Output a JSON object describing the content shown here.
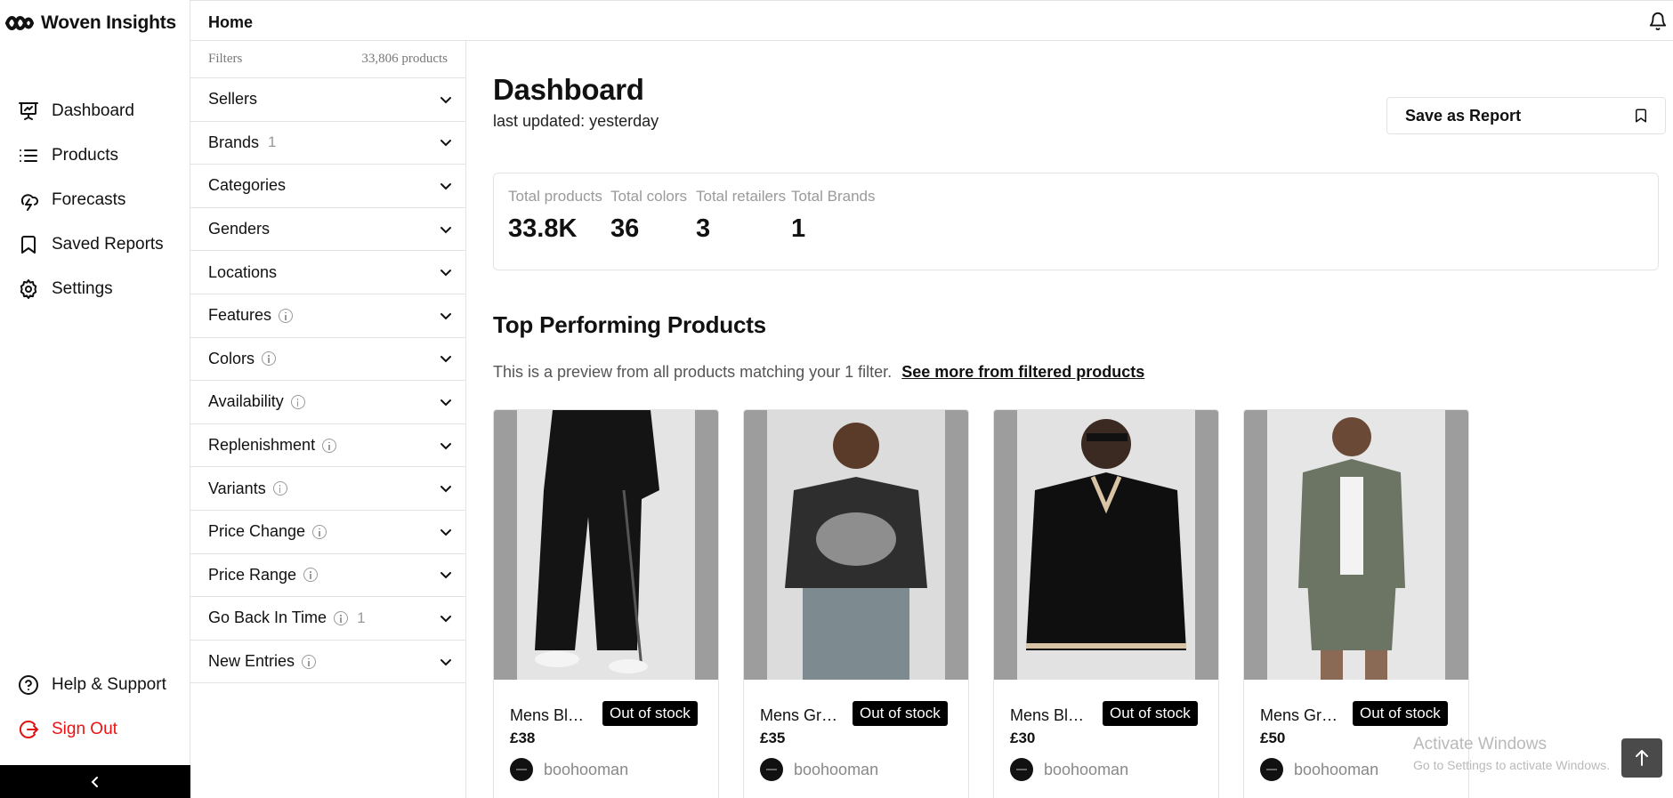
{
  "brand": {
    "name": "Woven Insights"
  },
  "nav": {
    "items": [
      {
        "label": "Dashboard",
        "icon": "presentation-icon"
      },
      {
        "label": "Products",
        "icon": "list-icon"
      },
      {
        "label": "Forecasts",
        "icon": "cloud-lightning-icon"
      },
      {
        "label": "Saved Reports",
        "icon": "bookmark-icon"
      },
      {
        "label": "Settings",
        "icon": "gear-icon"
      }
    ],
    "bottom": [
      {
        "label": "Help & Support",
        "icon": "help-icon"
      },
      {
        "label": "Sign Out",
        "icon": "sign-out-icon",
        "color": "#e11111"
      }
    ],
    "collapse_icon": "chevron-left-icon"
  },
  "topbar": {
    "breadcrumb": "Home",
    "icon": "bell-icon"
  },
  "filters": {
    "heading": "Filters",
    "product_count": "33,806 products",
    "rows": [
      {
        "label": "Sellers",
        "info": false,
        "count": ""
      },
      {
        "label": "Brands",
        "info": false,
        "count": "1"
      },
      {
        "label": "Categories",
        "info": false,
        "count": ""
      },
      {
        "label": "Genders",
        "info": false,
        "count": ""
      },
      {
        "label": "Locations",
        "info": false,
        "count": ""
      },
      {
        "label": "Features",
        "info": true,
        "count": ""
      },
      {
        "label": "Colors",
        "info": true,
        "count": ""
      },
      {
        "label": "Availability",
        "info": true,
        "count": ""
      },
      {
        "label": "Replenishment",
        "info": true,
        "count": ""
      },
      {
        "label": "Variants",
        "info": true,
        "count": ""
      },
      {
        "label": "Price Change",
        "info": true,
        "count": ""
      },
      {
        "label": "Price Range",
        "info": true,
        "count": ""
      },
      {
        "label": "Go Back In Time",
        "info": true,
        "count": "1"
      },
      {
        "label": "New Entries",
        "info": true,
        "count": ""
      }
    ]
  },
  "dashboard": {
    "title": "Dashboard",
    "last_updated": "last updated: yesterday",
    "save_label": "Save as Report",
    "stats": [
      {
        "label": "Total products",
        "value": "33.8K"
      },
      {
        "label": "Total colors",
        "value": "36"
      },
      {
        "label": "Total retailers",
        "value": "3"
      },
      {
        "label": "Total Brands",
        "value": "1"
      }
    ],
    "section_title": "Top Performing Products",
    "preview_text": "This is a preview from all products matching your 1 filter.",
    "preview_link": "See more from filtered products",
    "products": [
      {
        "name": "Mens Bla...",
        "status": "Out of stock",
        "price": "£38",
        "seller": "boohooman"
      },
      {
        "name": "Mens Gre...",
        "status": "Out of stock",
        "price": "£35",
        "seller": "boohooman"
      },
      {
        "name": "Mens Bla...",
        "status": "Out of stock",
        "price": "£30",
        "seller": "boohooman"
      },
      {
        "name": "Mens Gre...",
        "status": "Out of stock",
        "price": "£50",
        "seller": "boohooman"
      }
    ]
  },
  "watermark": {
    "line1": "Activate Windows",
    "line2": "Go to Settings to activate Windows."
  },
  "colors": {
    "accent": "#000000",
    "danger": "#e11111",
    "border": "#e3e3e3"
  }
}
